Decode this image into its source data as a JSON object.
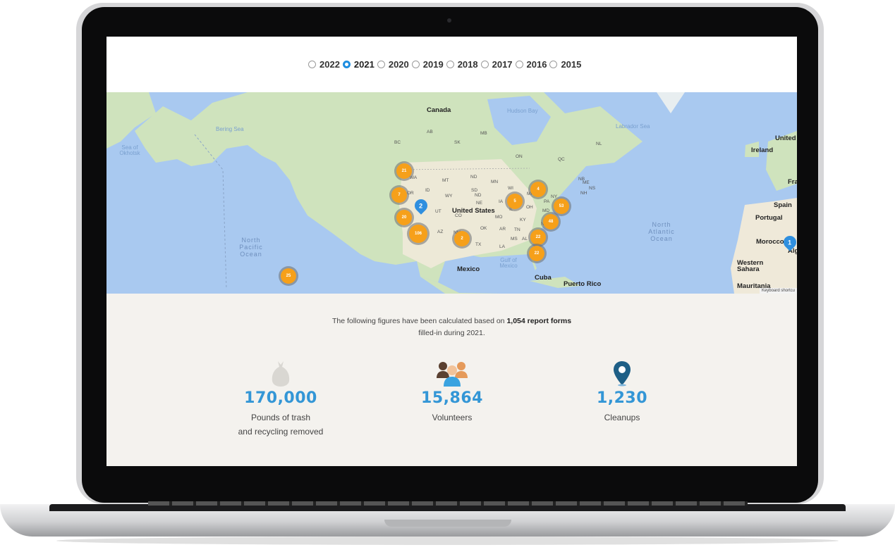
{
  "years": [
    {
      "label": "2022",
      "checked": false
    },
    {
      "label": "2021",
      "checked": true
    },
    {
      "label": "2020",
      "checked": false
    },
    {
      "label": "2019",
      "checked": false
    },
    {
      "label": "2018",
      "checked": false
    },
    {
      "label": "2017",
      "checked": false
    },
    {
      "label": "2016",
      "checked": false
    },
    {
      "label": "2015",
      "checked": false
    }
  ],
  "map": {
    "countries": [
      "Canada",
      "United States",
      "Mexico",
      "Cuba",
      "Puerto Rico",
      "Ireland",
      "United Kingdo",
      "Spain",
      "Portugal",
      "Morocco",
      "Western Sahara",
      "Mauritania",
      "Fra",
      "Alg"
    ],
    "waters": [
      "Bering Sea",
      "Sea of Okhotsk",
      "Hudson Bay",
      "Labrador Sea",
      "Gulf of Mexico"
    ],
    "oceans": [
      "North Pacific Ocean",
      "North Atlantic Ocean"
    ],
    "regions": [
      "AB",
      "BC",
      "SK",
      "MB",
      "ON",
      "QC",
      "NL",
      "WA",
      "OR",
      "MT",
      "ND",
      "MN",
      "WI",
      "MI",
      "NY",
      "ME",
      "NB",
      "NS",
      "NH",
      "SD",
      "WY",
      "NE",
      "IA",
      "UT",
      "CO",
      "MO",
      "KY",
      "NV",
      "AZ",
      "NM",
      "OK",
      "AR",
      "TN",
      "NC",
      "TX",
      "LA",
      "MS",
      "AL",
      "GA",
      "OH",
      "MD",
      "PA",
      "IL",
      "ID",
      "ND"
    ],
    "clusters": [
      "21",
      "7",
      "20",
      "106",
      "2",
      "25",
      "5",
      "4",
      "53",
      "48",
      "22",
      "22"
    ],
    "pins": [
      "2",
      "1"
    ],
    "keyboard_shortcuts": "Keyboard shortcu"
  },
  "intro": {
    "prefix": "The following figures have been calculated based on ",
    "count": "1,054 report forms",
    "suffix": "filled-in during 2021."
  },
  "stats": [
    {
      "value": "170,000",
      "label_line1": "Pounds of trash",
      "label_line2": "and recycling removed",
      "icon": "trash-bag-icon"
    },
    {
      "value": "15,864",
      "label_line1": "Volunteers",
      "label_line2": "",
      "icon": "volunteers-icon"
    },
    {
      "value": "1,230",
      "label_line1": "Cleanups",
      "label_line2": "",
      "icon": "location-pin-icon"
    }
  ],
  "colors": {
    "accent": "#3396d6",
    "cluster": "#f6a01a",
    "water": "#a9c9f0",
    "land": "#cfe3bd"
  }
}
